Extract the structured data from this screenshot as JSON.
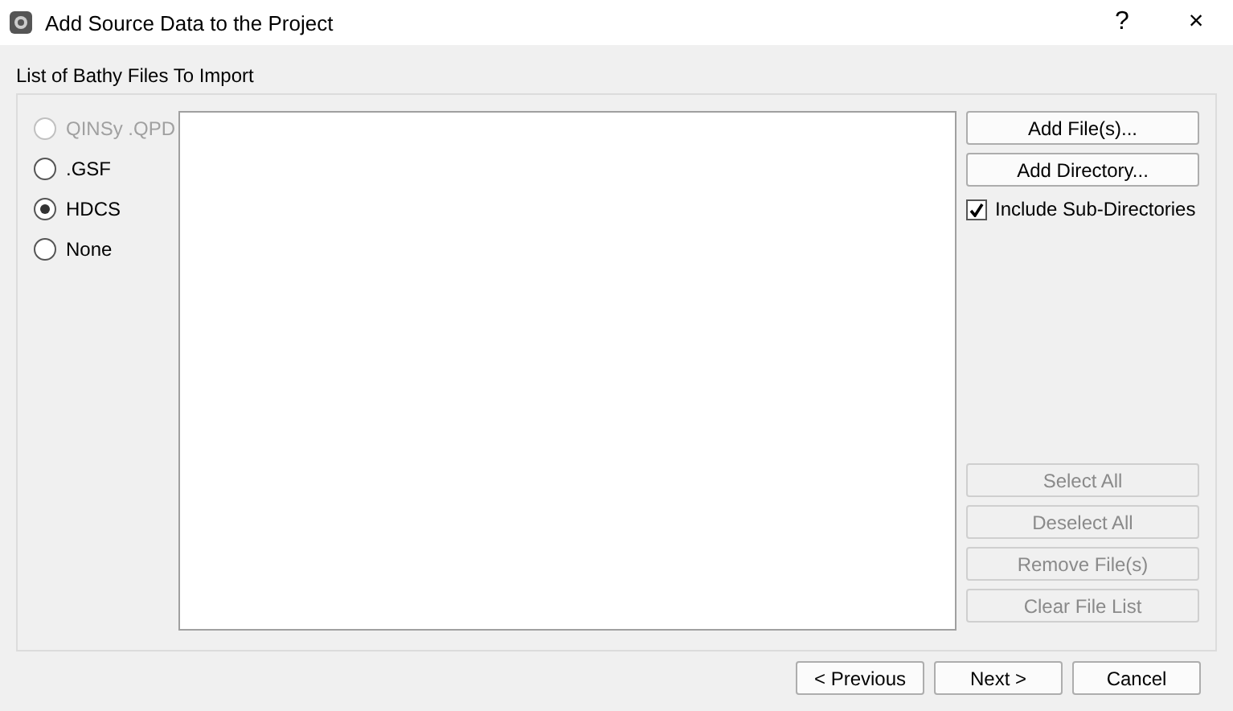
{
  "window": {
    "title": "Add Source Data to the Project",
    "help": "?",
    "close": "×"
  },
  "section_label": "List of Bathy Files To Import",
  "formats": [
    {
      "label": "QINSy .QPD",
      "selected": false,
      "disabled": true
    },
    {
      "label": ".GSF",
      "selected": false,
      "disabled": false
    },
    {
      "label": "HDCS",
      "selected": true,
      "disabled": false
    },
    {
      "label": "None",
      "selected": false,
      "disabled": false
    }
  ],
  "top_buttons": [
    {
      "label": "Add File(s)...",
      "disabled": false
    },
    {
      "label": "Add Directory...",
      "disabled": false
    }
  ],
  "include_subdirs": {
    "label": "Include Sub-Directories",
    "checked": true
  },
  "list_buttons": [
    {
      "label": "Select All",
      "disabled": true
    },
    {
      "label": "Deselect All",
      "disabled": true
    },
    {
      "label": "Remove File(s)",
      "disabled": true
    },
    {
      "label": "Clear File List",
      "disabled": true
    }
  ],
  "footer_buttons": [
    {
      "label": "< Previous"
    },
    {
      "label": "Next >"
    },
    {
      "label": "Cancel"
    }
  ]
}
